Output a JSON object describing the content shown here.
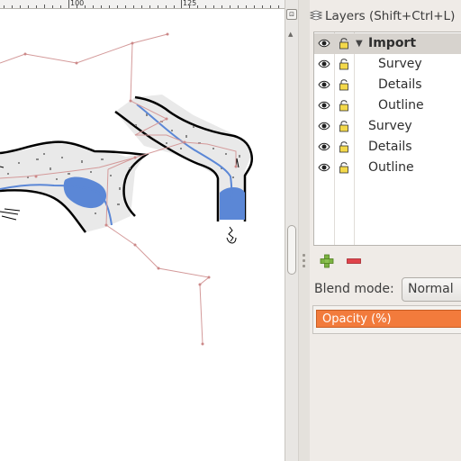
{
  "ruler": {
    "labels": [
      "100",
      "125"
    ]
  },
  "layers_panel": {
    "title": "Layers (Shift+Ctrl+L)",
    "layers": [
      {
        "label": "Import",
        "group": true,
        "expanded": true,
        "visible": true,
        "locked": true
      },
      {
        "label": "Survey",
        "indent": 1,
        "visible": true,
        "locked": true
      },
      {
        "label": "Details",
        "indent": 1,
        "visible": true,
        "locked": true
      },
      {
        "label": "Outline",
        "indent": 1,
        "visible": true,
        "locked": true
      },
      {
        "label": "Survey",
        "indent": 0,
        "visible": true,
        "locked": true
      },
      {
        "label": "Details",
        "indent": 0,
        "visible": true,
        "locked": true
      },
      {
        "label": "Outline",
        "indent": 0,
        "visible": true,
        "locked": true
      }
    ],
    "add_icon": "plus-icon",
    "remove_icon": "minus-icon",
    "blend_mode_label": "Blend mode:",
    "blend_mode_value": "Normal",
    "opacity_label": "Opacity (%)",
    "opacity_color": "#f27b3c"
  },
  "colors": {
    "water": "#5b87d6",
    "survey_line": "#d49a9a",
    "rock_fill": "#e9e9e9",
    "wall": "#000000"
  }
}
